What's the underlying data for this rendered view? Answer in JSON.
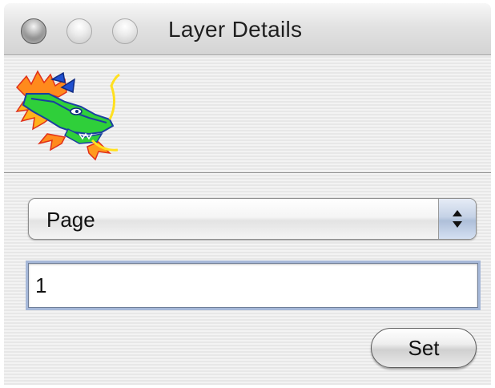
{
  "window": {
    "title": "Layer Details"
  },
  "titlebar": {
    "buttons": [
      "close",
      "minimize",
      "zoom"
    ]
  },
  "icon": {
    "name": "dragon-icon"
  },
  "layer_popup": {
    "selected": "Page"
  },
  "value_field": {
    "value": "1"
  },
  "actions": {
    "set_label": "Set"
  },
  "colors": {
    "focus_ring": "#a6b8d8",
    "popup_arrow_bg": "#c5d2e6"
  }
}
